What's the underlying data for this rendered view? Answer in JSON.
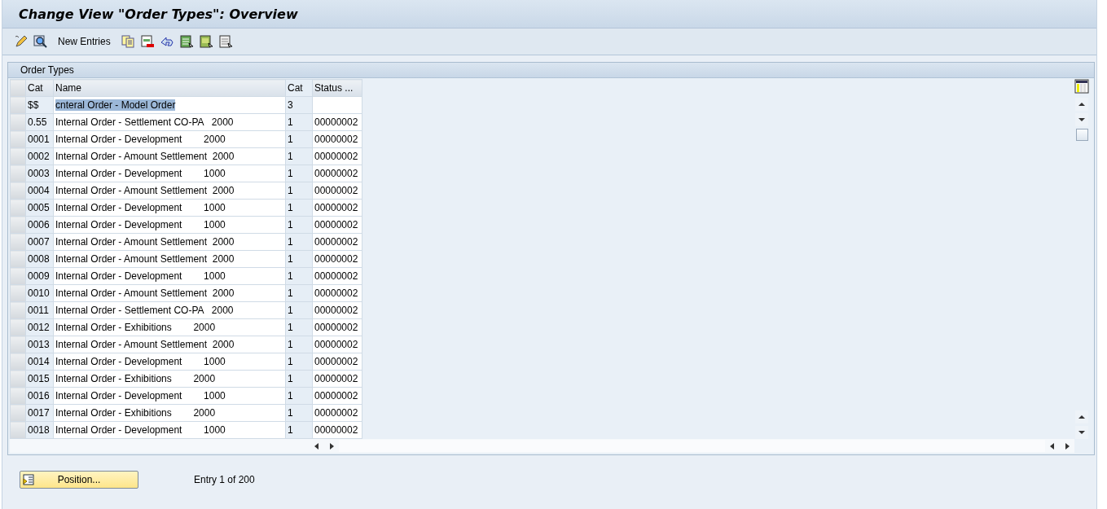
{
  "window": {
    "title": "Change View \"Order Types\": Overview"
  },
  "toolbar": {
    "new_entries": "New Entries"
  },
  "table": {
    "title": "Order Types",
    "columns": [
      "Cat",
      "Name",
      "Cat",
      "Status ..."
    ],
    "rows": [
      {
        "cells": [
          "$$",
          "cnteral Order - Model Order",
          "3",
          ""
        ],
        "selected": true
      },
      {
        "cells": [
          "0.55",
          "Internal Order - Settlement CO-PA   2000",
          "1",
          "00000002"
        ],
        "selected": false
      },
      {
        "cells": [
          "0001",
          "Internal Order - Development        2000",
          "1",
          "00000002"
        ],
        "selected": false
      },
      {
        "cells": [
          "0002",
          "Internal Order - Amount Settlement  2000",
          "1",
          "00000002"
        ],
        "selected": false
      },
      {
        "cells": [
          "0003",
          "Internal Order - Development        1000",
          "1",
          "00000002"
        ],
        "selected": false
      },
      {
        "cells": [
          "0004",
          "Internal Order - Amount Settlement  2000",
          "1",
          "00000002"
        ],
        "selected": false
      },
      {
        "cells": [
          "0005",
          "Internal Order - Development        1000",
          "1",
          "00000002"
        ],
        "selected": false
      },
      {
        "cells": [
          "0006",
          "Internal Order - Development        1000",
          "1",
          "00000002"
        ],
        "selected": false
      },
      {
        "cells": [
          "0007",
          "Internal Order - Amount Settlement  2000",
          "1",
          "00000002"
        ],
        "selected": false
      },
      {
        "cells": [
          "0008",
          "Internal Order - Amount Settlement  2000",
          "1",
          "00000002"
        ],
        "selected": false
      },
      {
        "cells": [
          "0009",
          "Internal Order - Development        1000",
          "1",
          "00000002"
        ],
        "selected": false
      },
      {
        "cells": [
          "0010",
          "Internal Order - Amount Settlement  2000",
          "1",
          "00000002"
        ],
        "selected": false
      },
      {
        "cells": [
          "0011",
          "Internal Order - Settlement CO-PA   2000",
          "1",
          "00000002"
        ],
        "selected": false
      },
      {
        "cells": [
          "0012",
          "Internal Order - Exhibitions        2000",
          "1",
          "00000002"
        ],
        "selected": false
      },
      {
        "cells": [
          "0013",
          "Internal Order - Amount Settlement  2000",
          "1",
          "00000002"
        ],
        "selected": false
      },
      {
        "cells": [
          "0014",
          "Internal Order - Development        1000",
          "1",
          "00000002"
        ],
        "selected": false
      },
      {
        "cells": [
          "0015",
          "Internal Order - Exhibitions        2000",
          "1",
          "00000002"
        ],
        "selected": false
      },
      {
        "cells": [
          "0016",
          "Internal Order - Development        1000",
          "1",
          "00000002"
        ],
        "selected": false
      },
      {
        "cells": [
          "0017",
          "Internal Order - Exhibitions        2000",
          "1",
          "00000002"
        ],
        "selected": false
      },
      {
        "cells": [
          "0018",
          "Internal Order - Development        1000",
          "1",
          "00000002"
        ],
        "selected": false
      }
    ]
  },
  "footer": {
    "position_button": "Position...",
    "entry_info": "Entry 1 of 200"
  }
}
